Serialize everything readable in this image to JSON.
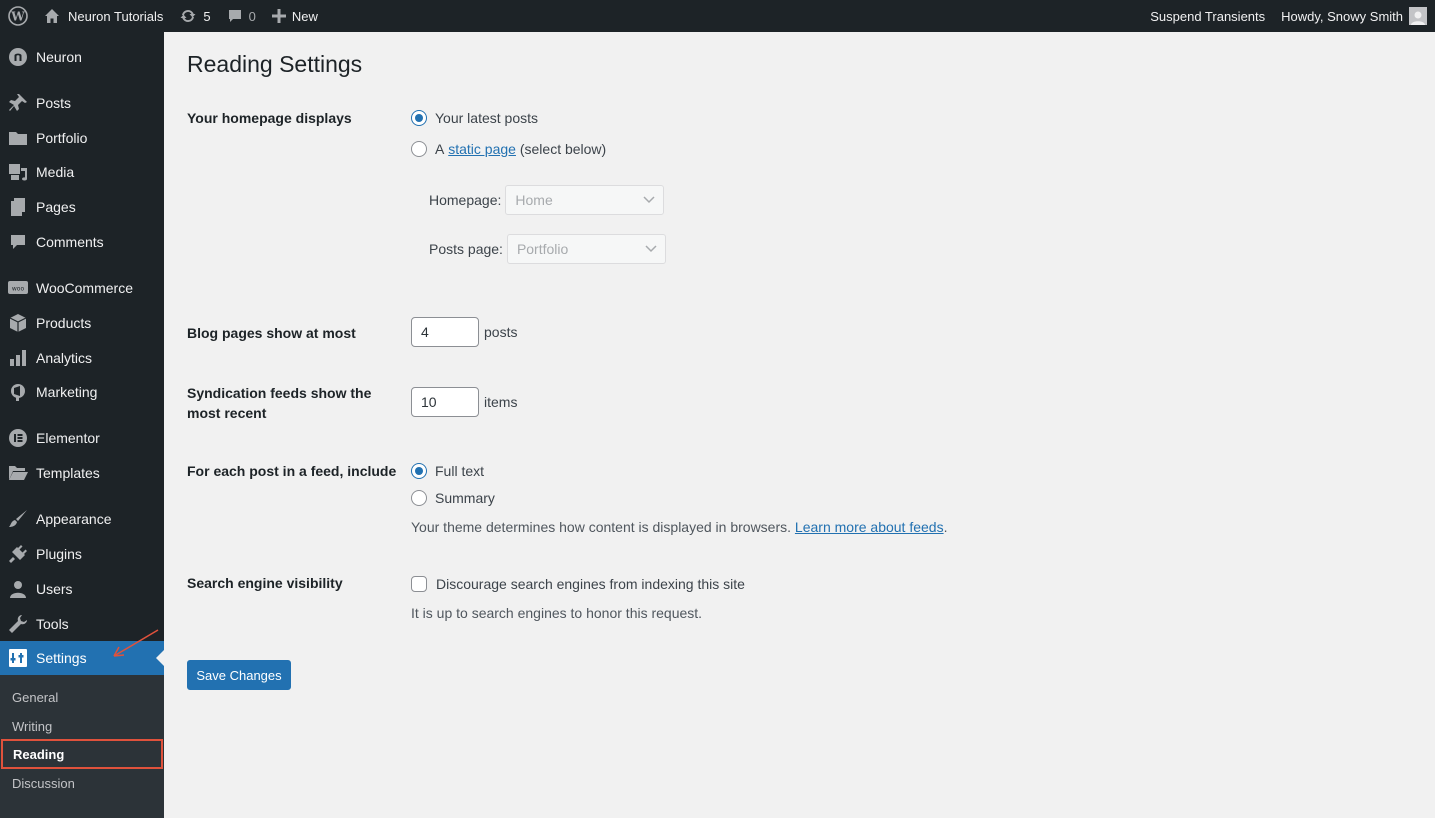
{
  "adminbar": {
    "site_name": "Neuron Tutorials",
    "updates_count": "5",
    "comments_count": "0",
    "new_label": "New",
    "suspend_label": "Suspend Transients",
    "howdy_label": "Howdy, Snowy Smith"
  },
  "sidebar": {
    "items": [
      {
        "label": "Neuron",
        "icon": "neuron-icon"
      },
      {
        "label": "Posts",
        "icon": "pin-icon"
      },
      {
        "label": "Portfolio",
        "icon": "folder-icon"
      },
      {
        "label": "Media",
        "icon": "media-icon"
      },
      {
        "label": "Pages",
        "icon": "pages-icon"
      },
      {
        "label": "Comments",
        "icon": "comment-icon"
      },
      {
        "label": "WooCommerce",
        "icon": "woo-icon",
        "icon_text": "woo"
      },
      {
        "label": "Products",
        "icon": "box-icon"
      },
      {
        "label": "Analytics",
        "icon": "bar-chart-icon"
      },
      {
        "label": "Marketing",
        "icon": "megaphone-icon"
      },
      {
        "label": "Elementor",
        "icon": "elementor-icon"
      },
      {
        "label": "Templates",
        "icon": "folder-open-icon"
      },
      {
        "label": "Appearance",
        "icon": "brush-icon"
      },
      {
        "label": "Plugins",
        "icon": "plug-icon"
      },
      {
        "label": "Users",
        "icon": "user-icon"
      },
      {
        "label": "Tools",
        "icon": "wrench-icon"
      },
      {
        "label": "Settings",
        "icon": "settings-icon"
      }
    ],
    "submenu": [
      "General",
      "Writing",
      "Reading",
      "Discussion"
    ]
  },
  "page": {
    "title": "Reading Settings",
    "homepage_displays": {
      "label": "Your homepage displays",
      "option_latest": "Your latest posts",
      "option_static_prefix": "A",
      "option_static_link": "static page",
      "option_static_suffix": "(select below)",
      "homepage_label": "Homepage:",
      "homepage_value": "Home",
      "posts_page_label": "Posts page:",
      "posts_page_value": "Portfolio",
      "selected": "latest"
    },
    "blog_pages": {
      "label": "Blog pages show at most",
      "value": "4",
      "unit": "posts"
    },
    "syndication": {
      "label": "Syndication feeds show the most recent",
      "value": "10",
      "unit": "items"
    },
    "feed_include": {
      "label": "For each post in a feed, include",
      "option_full": "Full text",
      "option_summary": "Summary",
      "selected": "full",
      "desc": "Your theme determines how content is displayed in browsers.",
      "desc_link": "Learn more about feeds",
      "desc_end": "."
    },
    "search_visibility": {
      "label": "Search engine visibility",
      "checkbox_label": "Discourage search engines from indexing this site",
      "checked": false,
      "desc": "It is up to search engines to honor this request."
    },
    "save_label": "Save Changes"
  },
  "colors": {
    "accent": "#2271b1",
    "highlight": "#e0523c",
    "adminbar_bg": "#1d2327"
  }
}
